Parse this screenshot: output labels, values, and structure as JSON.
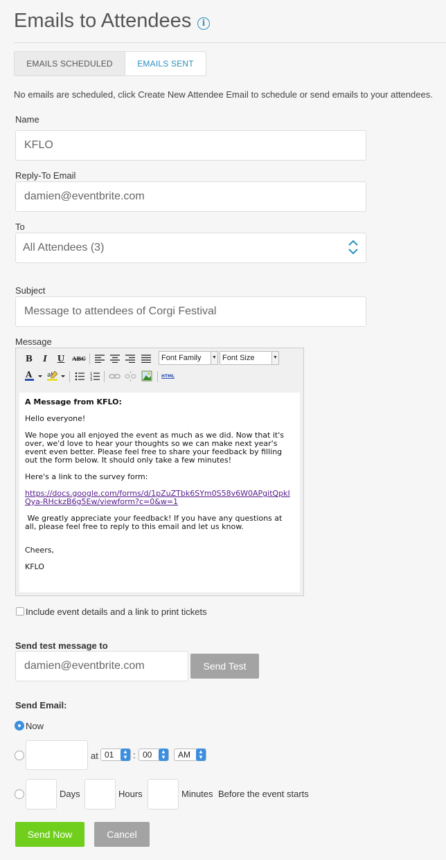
{
  "page": {
    "title": "Emails to Attendees",
    "info_icon": "i"
  },
  "tabs": [
    {
      "label": "EMAILS SCHEDULED",
      "active": false
    },
    {
      "label": "EMAILS SENT",
      "active": true
    }
  ],
  "notice": "No emails are scheduled, click Create New Attendee Email to schedule or send emails to your attendees.",
  "form": {
    "name_label": "Name",
    "name_value": "KFLO",
    "reply_label": "Reply-To Email",
    "reply_value": "damien@eventbrite.com",
    "to_label": "To",
    "to_value": "All Attendees (3)",
    "subject_label": "Subject",
    "subject_value": "Message to attendees of Corgi Festival",
    "message_label": "Message"
  },
  "toolbar": {
    "bold": "B",
    "italic": "I",
    "underline": "U",
    "strike": "ABC",
    "font_family": "Font Family",
    "font_size": "Font Size",
    "html": "HTML"
  },
  "message": {
    "heading": "A Message from KFLO:",
    "greeting": "Hello everyone!",
    "para1": "We hope you all enjoyed the event as much as we did. Now that it's over, we'd love to hear your thoughts so we can make next year's event even better. Please feel free to share your feedback by filling out the form below. It should only take a few minutes!",
    "para2": "Here's a link to the survey form:",
    "link": "https://docs.google.com/forms/d/1pZuZTbk6SYm0S58v6W0APgitQpkIQya-RHckzB6g5Ew/viewform?c=0&w=1",
    "para3": " We greatly appreciate your feedback! If you have any questions at all, please feel free to reply to this email and let us know.",
    "closing": "Cheers,",
    "signature": "KFLO"
  },
  "include_details": {
    "label": "Include event details and a link to print tickets",
    "checked": false
  },
  "test": {
    "label": "Send test message to",
    "value": "damien@eventbrite.com",
    "button": "Send Test"
  },
  "send": {
    "label": "Send Email:",
    "now_label": "Now",
    "at_label": "at",
    "hour": "01",
    "colon": ":",
    "minute": "00",
    "ampm": "AM",
    "days_label": "Days",
    "hours_label": "Hours",
    "minutes_label": "Minutes",
    "before_label": "Before the event starts",
    "send_now": "Send Now",
    "cancel": "Cancel"
  },
  "colors": {
    "accent": "#2a8fbd",
    "green": "#6fcf1c",
    "radio": "#3c8fde"
  }
}
